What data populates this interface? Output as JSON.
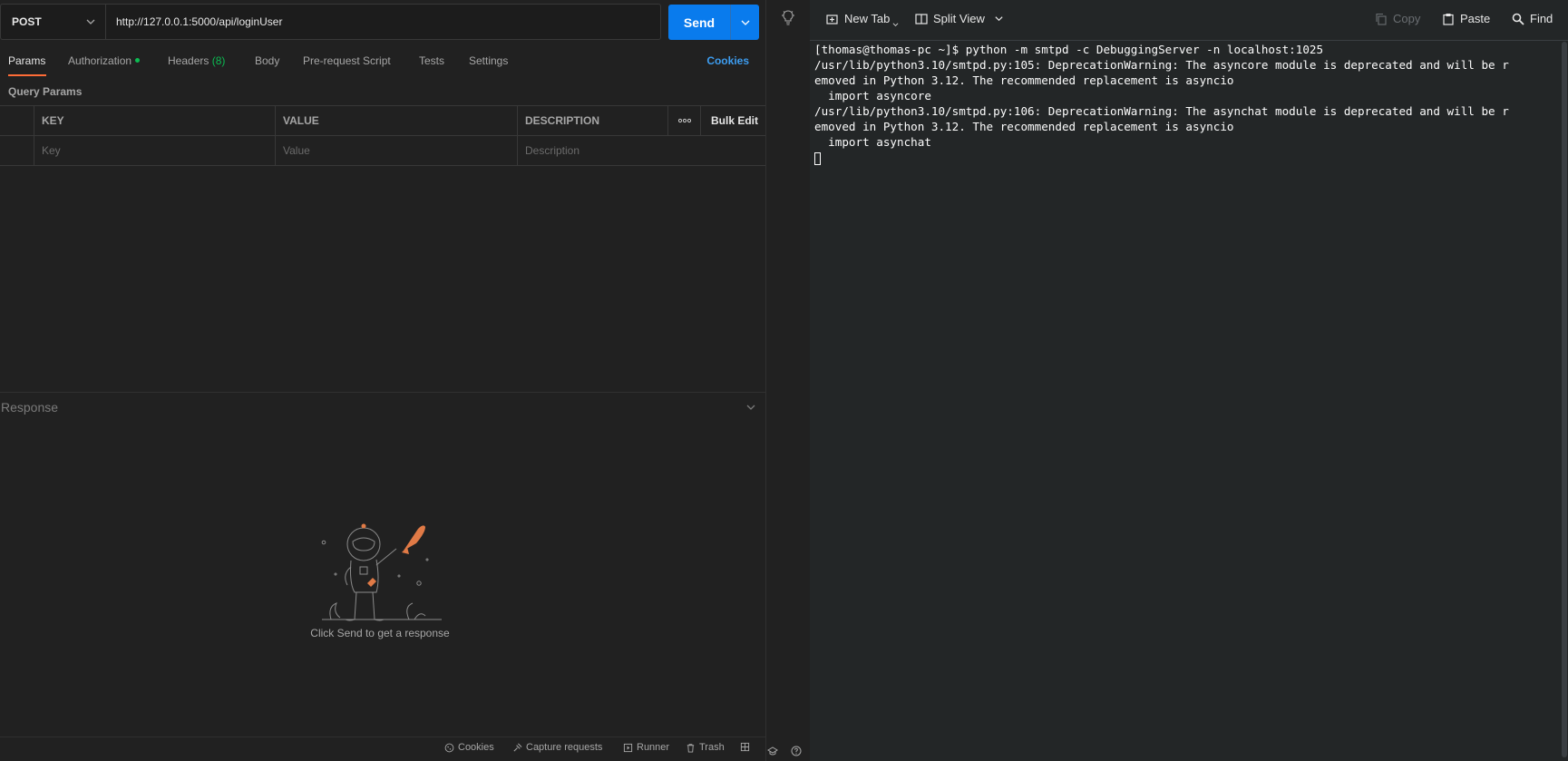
{
  "request": {
    "method": "POST",
    "url": "http://127.0.0.1:5000/api/loginUser",
    "send_label": "Send"
  },
  "tabs": [
    {
      "label": "Params"
    },
    {
      "label": "Authorization"
    },
    {
      "label": "Headers",
      "count": "(8)"
    },
    {
      "label": "Body"
    },
    {
      "label": "Pre-request Script"
    },
    {
      "label": "Tests"
    },
    {
      "label": "Settings"
    }
  ],
  "cookies_link": "Cookies",
  "query_params": {
    "title": "Query Params",
    "headers": [
      "KEY",
      "VALUE",
      "DESCRIPTION"
    ],
    "bulk_edit": "Bulk Edit",
    "placeholders": {
      "key": "Key",
      "value": "Value",
      "description": "Description"
    }
  },
  "response": {
    "label": "Response",
    "empty_message": "Click Send to get a response"
  },
  "statusbar": [
    {
      "label": "Cookies",
      "icon": "cookie-icon"
    },
    {
      "label": "Capture requests",
      "icon": "capture-icon"
    },
    {
      "label": "Runner",
      "icon": "runner-icon"
    },
    {
      "label": "Trash",
      "icon": "trash-icon"
    }
  ],
  "terminal": {
    "toolbar": {
      "new_tab": "New Tab",
      "split_view": "Split View",
      "copy": "Copy",
      "paste": "Paste",
      "find": "Find"
    },
    "lines": [
      "[thomas@thomas-pc ~]$ python -m smtpd -c DebuggingServer -n localhost:1025",
      "/usr/lib/python3.10/smtpd.py:105: DeprecationWarning: The asyncore module is deprecated and will be r",
      "emoved in Python 3.12. The recommended replacement is asyncio",
      "  import asyncore",
      "/usr/lib/python3.10/smtpd.py:106: DeprecationWarning: The asynchat module is deprecated and will be r",
      "emoved in Python 3.12. The recommended replacement is asyncio",
      "  import asynchat"
    ]
  },
  "colors": {
    "accent": "#097bed",
    "tab_indicator": "#ff6c37",
    "status_ok": "#0cbb52",
    "link": "#3d9df0"
  }
}
